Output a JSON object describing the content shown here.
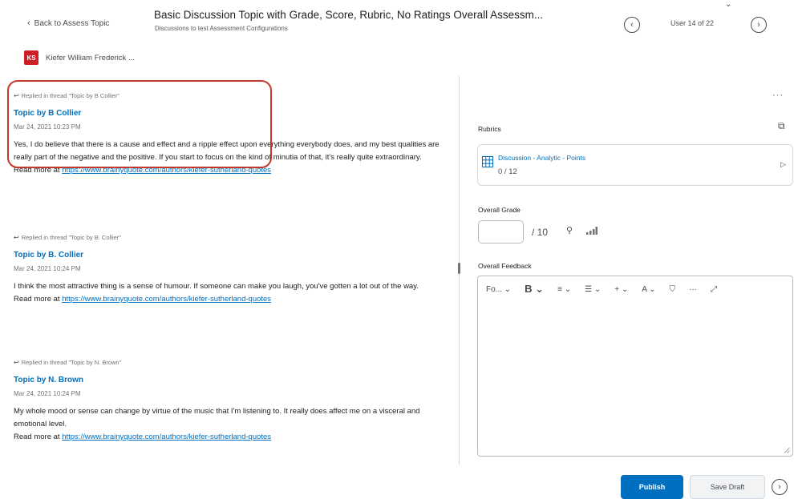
{
  "header": {
    "back_label": "Back to Assess Topic",
    "title": "Basic Discussion Topic with Grade, Score, Rubric, No Ratings Overall Assessm...",
    "subtitle": "Discussions to test Assessment Configurations",
    "user_count": "User 14 of 22"
  },
  "user": {
    "initials": "KS",
    "name": "Kiefer William Frederick ..."
  },
  "posts": [
    {
      "replied": "Replied in thread \"Topic by B Collier\"",
      "title": "Topic by B Collier",
      "date": "Mar 24, 2021 10:23 PM",
      "body": "Yes, I do believe that there is a cause and effect and a ripple effect upon everything everybody does, and my best qualities are really part of the negative and the positive. If you start to focus on the kind of minutia of that, it's really quite extraordinary.",
      "read_more": "Read more at",
      "link": "https://www.brainyquote.com/authors/kiefer-sutherland-quotes"
    },
    {
      "replied": "Replied in thread \"Topic by B. Collier\"",
      "title": "Topic by B. Collier",
      "date": "Mar 24, 2021 10:24 PM",
      "body": "I think the most attractive thing is a sense of humour. If someone can make you laugh, you've gotten a lot out of the way.",
      "read_more": "Read more at",
      "link": "https://www.brainyquote.com/authors/kiefer-sutherland-quotes"
    },
    {
      "replied": "Replied in thread \"Topic by N. Brown\"",
      "title": "Topic by N. Brown",
      "date": "Mar 24, 2021 10:24 PM",
      "body": "My whole mood or sense can change by virtue of the music that I'm listening to. It really does affect me on a visceral and emotional level.",
      "read_more": "Read more at",
      "link": "https://www.brainyquote.com/authors/kiefer-sutherland-quotes"
    }
  ],
  "panel": {
    "more": "···",
    "rubrics_label": "Rubrics",
    "rubric_name": "Discussion - Analytic - Points",
    "rubric_score": "0 / 12",
    "grade_label": "Overall Grade",
    "grade_value": "",
    "grade_out_of": "/ 10",
    "feedback_label": "Overall Feedback",
    "toolbar": {
      "format": "Fo... ⌄",
      "bold": "B ⌄",
      "align": "≡ ⌄",
      "list": "☰ ⌄",
      "insert": "+ ⌄",
      "text_style": "A ⌄",
      "paint": "⛉",
      "more": "···",
      "fullscreen": "⤢"
    }
  },
  "footer": {
    "publish": "Publish",
    "save_draft": "Save Draft"
  }
}
